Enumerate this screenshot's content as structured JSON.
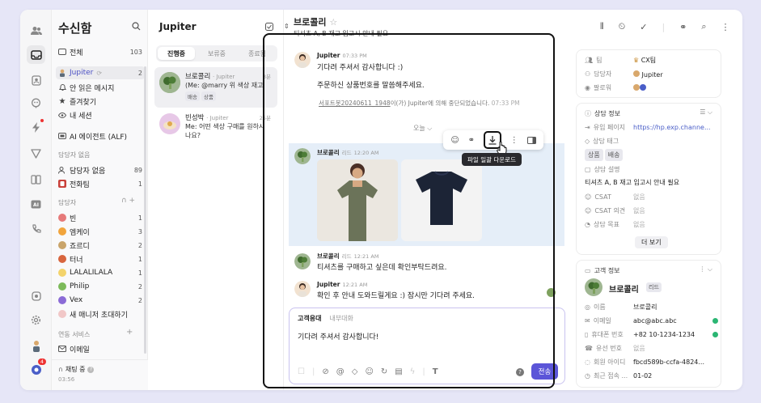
{
  "sidebar": {
    "title": "수신함",
    "items": [
      {
        "label": "전체",
        "count": "103"
      },
      {
        "label": "Jupiter",
        "count": "2"
      },
      {
        "label": "안 읽은 메시지",
        "count": ""
      },
      {
        "label": "즐겨찾기",
        "count": ""
      },
      {
        "label": "내 세션",
        "count": ""
      },
      {
        "label": "AI 에이전트 (ALF)",
        "count": ""
      }
    ],
    "section_unassigned": "담당자 없음",
    "unassigned_items": [
      {
        "label": "담당자 없음",
        "count": "89"
      },
      {
        "label": "전화팀",
        "count": "1"
      }
    ],
    "section_assignee": "담당자",
    "assignees": [
      {
        "label": "빈",
        "count": "1"
      },
      {
        "label": "엠케이",
        "count": "3"
      },
      {
        "label": "죠르디",
        "count": "2"
      },
      {
        "label": "터너",
        "count": "1"
      },
      {
        "label": "LALALILALA",
        "count": "1"
      },
      {
        "label": "Philip",
        "count": "2"
      },
      {
        "label": "Vex",
        "count": "2"
      },
      {
        "label": "새 매니저 초대하기",
        "count": ""
      }
    ],
    "section_integration": "연동 서비스",
    "integration_items": [
      {
        "label": "이메일"
      }
    ],
    "status": "채팅 중",
    "status_time": "03:56",
    "badge": "4"
  },
  "list": {
    "title": "Jupiter",
    "tabs": [
      "진행중",
      "보류중",
      "종료됨"
    ],
    "conversations": [
      {
        "name": "브로콜리",
        "sub": "· Jupiter",
        "time": "3분",
        "preview": "(Me: @marry 위 색상 재고 ... )",
        "tags": [
          "배송",
          "상품"
        ]
      },
      {
        "name": "빈성박",
        "sub": "· Jupiter",
        "time": "25분",
        "preview": "Me: 어떤 색상 구매를 원하시나요?",
        "tags": []
      }
    ]
  },
  "chat": {
    "title": "브로콜리",
    "subtitle": "티셔츠 A, B 재고 입고시 안내 필요",
    "messages": [
      {
        "name": "Jupiter",
        "time": "07:33 PM",
        "lines": [
          "기다려 주셔서 감사합니다 :)",
          "주문하신 상품번호를 말씀해주세요."
        ]
      },
      {
        "system_link": "서포트봇20240611_1948",
        "system_text": "이(가) Jupiter에 의해 중단되었습니다.",
        "system_time": "07:33 PM"
      },
      {
        "divider": "오늘"
      },
      {
        "name": "브로콜리",
        "role": "리드",
        "time": "12:20 AM"
      },
      {
        "name": "브로콜리",
        "role": "리드",
        "time": "12:21 AM",
        "lines": [
          "티셔츠를 구매하고 싶은데 확인부탁드려요."
        ]
      },
      {
        "name": "Jupiter",
        "time": "12:21 AM",
        "lines": [
          "확인 후 안내 도와드릴게요 :) 잠시만 기다려 주세요."
        ]
      }
    ],
    "tooltip": "파일 일괄 다운로드",
    "composer": {
      "tab_active": "고객응대",
      "tab_other": "내부대화",
      "text": "기다려 주셔서 감사합니다!",
      "send": "전송"
    }
  },
  "right": {
    "team_label": "팀",
    "team_value": "CX팀",
    "assignee_label": "담당자",
    "assignee_value": "Jupiter",
    "follower_label": "팔로워",
    "consult_title": "상담 정보",
    "inflow_label": "유입 페이지",
    "inflow_value": "https://hp.exp.channe...",
    "tag_label": "상담 태그",
    "tags": [
      "상품",
      "배송"
    ],
    "desc_label": "상담 설명",
    "desc_value": "티셔츠 A, B 재고 입고시 안내 필요",
    "csat_label": "CSAT",
    "csat_value": "없음",
    "csat_comment_label": "CSAT 의견",
    "csat_comment_value": "없음",
    "goal_label": "상담 목표",
    "goal_value": "없음",
    "more": "더 보기",
    "customer_title": "고객 정보",
    "customer_name": "브로콜리",
    "customer_role": "리드",
    "name_label": "이름",
    "name_value": "브로콜리",
    "email_label": "이메일",
    "email_value": "abc@abc.abc",
    "phone_label": "휴대폰 번호",
    "phone_value": "+82 10-1234-1234",
    "landline_label": "유선 번호",
    "landline_value": "없음",
    "member_label": "회원 아이디",
    "member_value": "fbcd589b-ccfa-4824...",
    "last_label": "최근 접속 ...",
    "last_value": "01-02"
  },
  "colors": {
    "accent": "#5b55d8",
    "bg": "#e6e6f7",
    "highlight_border": "#111111"
  }
}
